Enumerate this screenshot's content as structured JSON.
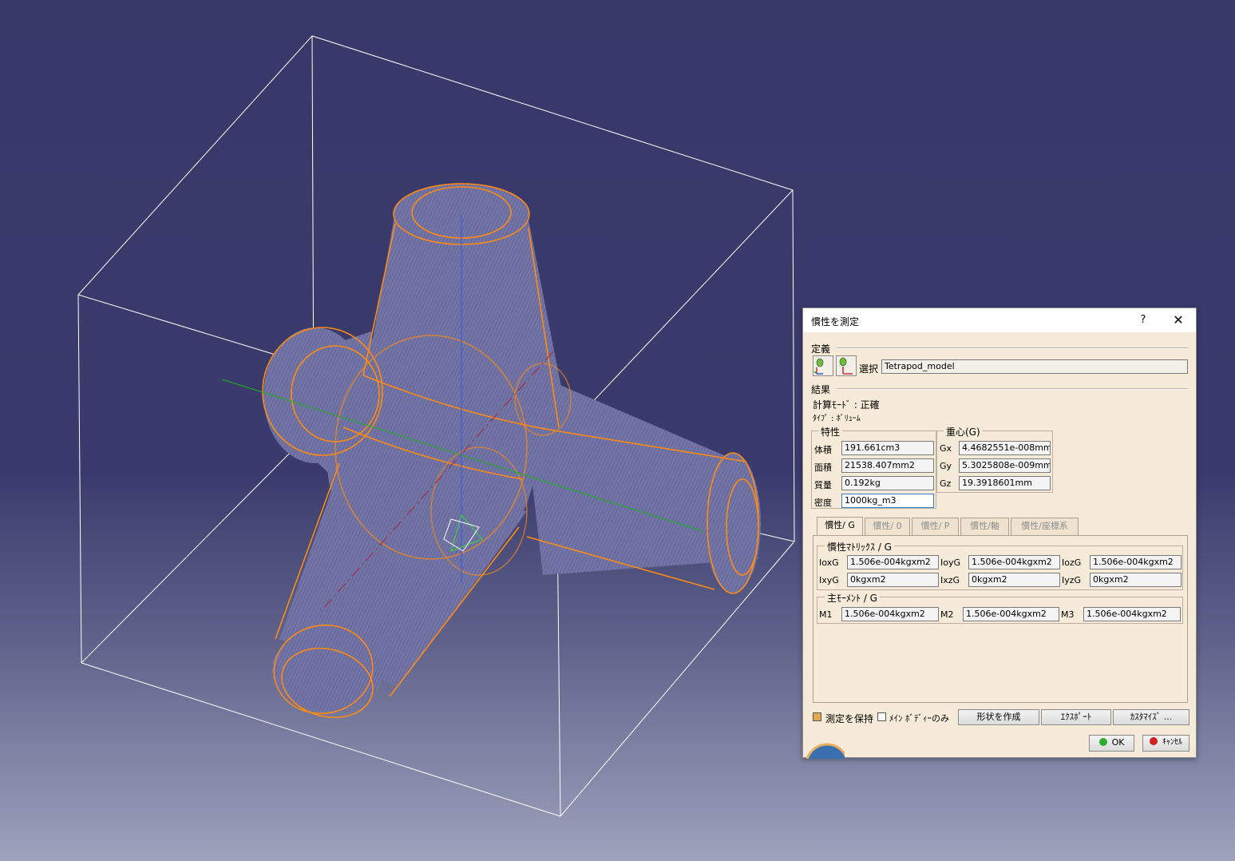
{
  "dialog": {
    "title": "慣性を測定",
    "help_icon": "?",
    "close_icon": "✕",
    "definition_label": "定義",
    "selection_label": "選択",
    "selection_value": "Tetrapod_model",
    "results_label": "結果",
    "calc_mode_line": "計算ﾓｰﾄﾞ : 正確",
    "type_line": "ﾀｲﾌﾟ : ﾎﾞﾘｭｰﾑ",
    "properties": {
      "group_label": "特性",
      "volume_label": "体積",
      "volume_value": "191.661cm3",
      "area_label": "面積",
      "area_value": "21538.407mm2",
      "mass_label": "質量",
      "mass_value": "0.192kg",
      "density_label": "密度",
      "density_value": "1000kg_m3"
    },
    "cog": {
      "group_label": "重心(G)",
      "gx_label": "Gx",
      "gx_value": "4.4682551e-008mm",
      "gy_label": "Gy",
      "gy_value": "5.3025808e-009mm",
      "gz_label": "Gz",
      "gz_value": "19.3918601mm"
    },
    "tabs": [
      "慣性/ G",
      "慣性/ 0",
      "慣性/ P",
      "慣性/軸",
      "慣性/座標系"
    ],
    "matrix": {
      "group_label": "慣性ﾏﾄﾘｯｸｽ / G",
      "ioxg_label": "IoxG",
      "ioxg_value": "1.506e-004kgxm2",
      "ioyg_label": "IoyG",
      "ioyg_value": "1.506e-004kgxm2",
      "iozg_label": "IozG",
      "iozg_value": "1.506e-004kgxm2",
      "ixyg_label": "IxyG",
      "ixyg_value": "0kgxm2",
      "ixzg_label": "IxzG",
      "ixzg_value": "0kgxm2",
      "iyzg_label": "IyzG",
      "iyzg_value": "0kgxm2"
    },
    "moments": {
      "group_label": "主ﾓｰﾒﾝﾄ / G",
      "m1_label": "M1",
      "m1_value": "1.506e-004kgxm2",
      "m2_label": "M2",
      "m2_value": "1.506e-004kgxm2",
      "m3_label": "M3",
      "m3_value": "1.506e-004kgxm2"
    },
    "keep_measure_label": "測定を保持",
    "keep_measure_checked": true,
    "main_body_only_label": "ﾒｲﾝ ﾎﾞﾃﾞｨｰのみ",
    "main_body_only_checked": false,
    "create_geometry_label": "形状を作成",
    "export_label": "ｴｸｽﾎﾟｰﾄ",
    "customize_label": "ｶｽﾀﾏｲｽﾞ ...",
    "ok_label": "OK",
    "cancel_label": "ｷｬﾝｾﾙ"
  },
  "colors": {
    "background_top": "#383869",
    "background_bottom": "#9ea2bc",
    "edge_highlight": "#ff8a14",
    "bounding_box": "#ffffff",
    "axis_x": "#1fb01f",
    "axis_y": "#2d5ae0",
    "axis_z": "#b0203a"
  }
}
